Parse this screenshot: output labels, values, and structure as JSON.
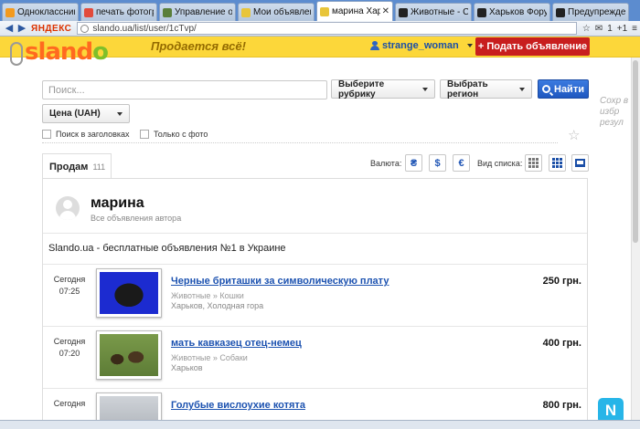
{
  "browser": {
    "tabs": [
      {
        "title": "Одноклассники",
        "color": "#f39a1e"
      },
      {
        "title": "печать фотогра",
        "color": "#e24b3b"
      },
      {
        "title": "Управление об",
        "color": "#5a7f3a"
      },
      {
        "title": "Мои объявлени",
        "color": "#e8c53a"
      },
      {
        "title": "марина Харь",
        "color": "#e8c53a",
        "active": true,
        "close": "✕"
      },
      {
        "title": "Животные - Ст",
        "color": "#222222"
      },
      {
        "title": "Харьков Форум",
        "color": "#222222"
      },
      {
        "title": "Предупрежден",
        "color": "#222222"
      }
    ],
    "back": "◀",
    "forward": "▶",
    "search_engine": "ЯНДЕКС",
    "url": "slando.ua/list/user/1cTvp/",
    "toolbar": {
      "mail_count": "1",
      "plus_count": "+1"
    }
  },
  "site": {
    "logo": {
      "part1": "sland",
      "part2": "o"
    },
    "tagline": "Продается всё!",
    "username": "strange_woman",
    "post_button": "+ Подать объявление",
    "brand_color": "#fcd73a",
    "accent_red": "#c81e1e"
  },
  "search": {
    "placeholder": "Поиск...",
    "category_select": "Выберите рубрику",
    "region_select": "Выбрать регион",
    "find_button": "Найти",
    "price_select": "Цена (UAH)",
    "search_in_titles": "Поиск в заголовках",
    "only_with_photo": "Только с фото",
    "save_hint": "Сохр в избр резул"
  },
  "listing_header": {
    "tab_label": "Продам",
    "tab_count": "111",
    "currency_label": "Валюта:",
    "currencies": [
      "₴",
      "$",
      "€"
    ],
    "view_label": "Вид списка:"
  },
  "author": {
    "name": "марина",
    "subtitle": "Все объявления автора"
  },
  "slogan": "Slando.ua - бесплатные объявления №1 в Украине",
  "listings": [
    {
      "day": "Сегодня",
      "time": "07:25",
      "title": "Черные бриташки за символическую плату",
      "category": "Животные » Кошки",
      "location": "Харьков, Холодная гора",
      "price": "250 грн."
    },
    {
      "day": "Сегодня",
      "time": "07:20",
      "title": "мать кавказец отец-немец",
      "category": "Животные » Собаки",
      "location": "Харьков",
      "price": "400 грн."
    },
    {
      "day": "Сегодня",
      "time": "",
      "title": "Голубые вислоухие котята",
      "category": "",
      "location": "",
      "price": "800 грн."
    }
  ],
  "corner_badge": "N"
}
